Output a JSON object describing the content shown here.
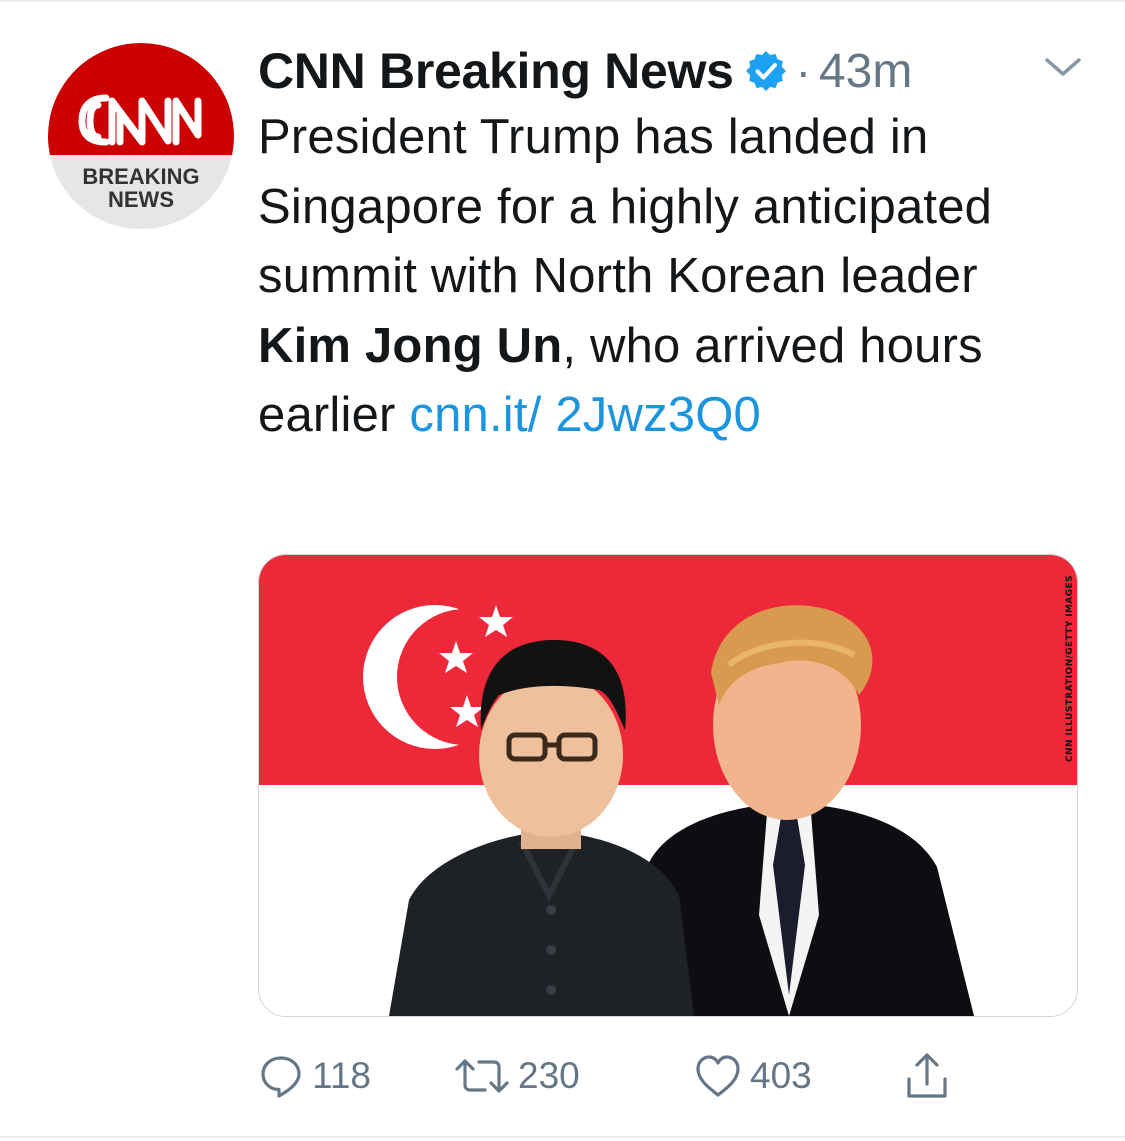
{
  "tweet": {
    "author": {
      "display_name": "CNN Breaking News",
      "verified": true,
      "avatar": {
        "logo_text": "CNN",
        "badge_line1": "BREAKING",
        "badge_line2": "NEWS",
        "logo_color": "#cc0000"
      }
    },
    "separator": "·",
    "timestamp": "43m",
    "menu_icon": "chevron-down-icon",
    "text": {
      "part1": "President Trump has landed in Singapore for a highly anticipated summit with North Korean leader ",
      "mention": "Kim Jong Un",
      "part2": ", who arrived hours earlier ",
      "link": "cnn.it/ 2Jwz3Q0"
    },
    "media": {
      "credit": "CNN ILLUSTRATION/GETTY IMAGES",
      "flag_colors": {
        "red": "#ed2939",
        "white": "#ffffff"
      }
    },
    "actions": {
      "reply": {
        "icon": "reply-icon",
        "count": "118"
      },
      "retweet": {
        "icon": "retweet-icon",
        "count": "230"
      },
      "like": {
        "icon": "heart-icon",
        "count": "403"
      },
      "share": {
        "icon": "share-icon"
      }
    }
  },
  "colors": {
    "text": "#14171a",
    "secondary": "#657786",
    "link": "#1b95e0",
    "verified": "#1da1f2"
  }
}
